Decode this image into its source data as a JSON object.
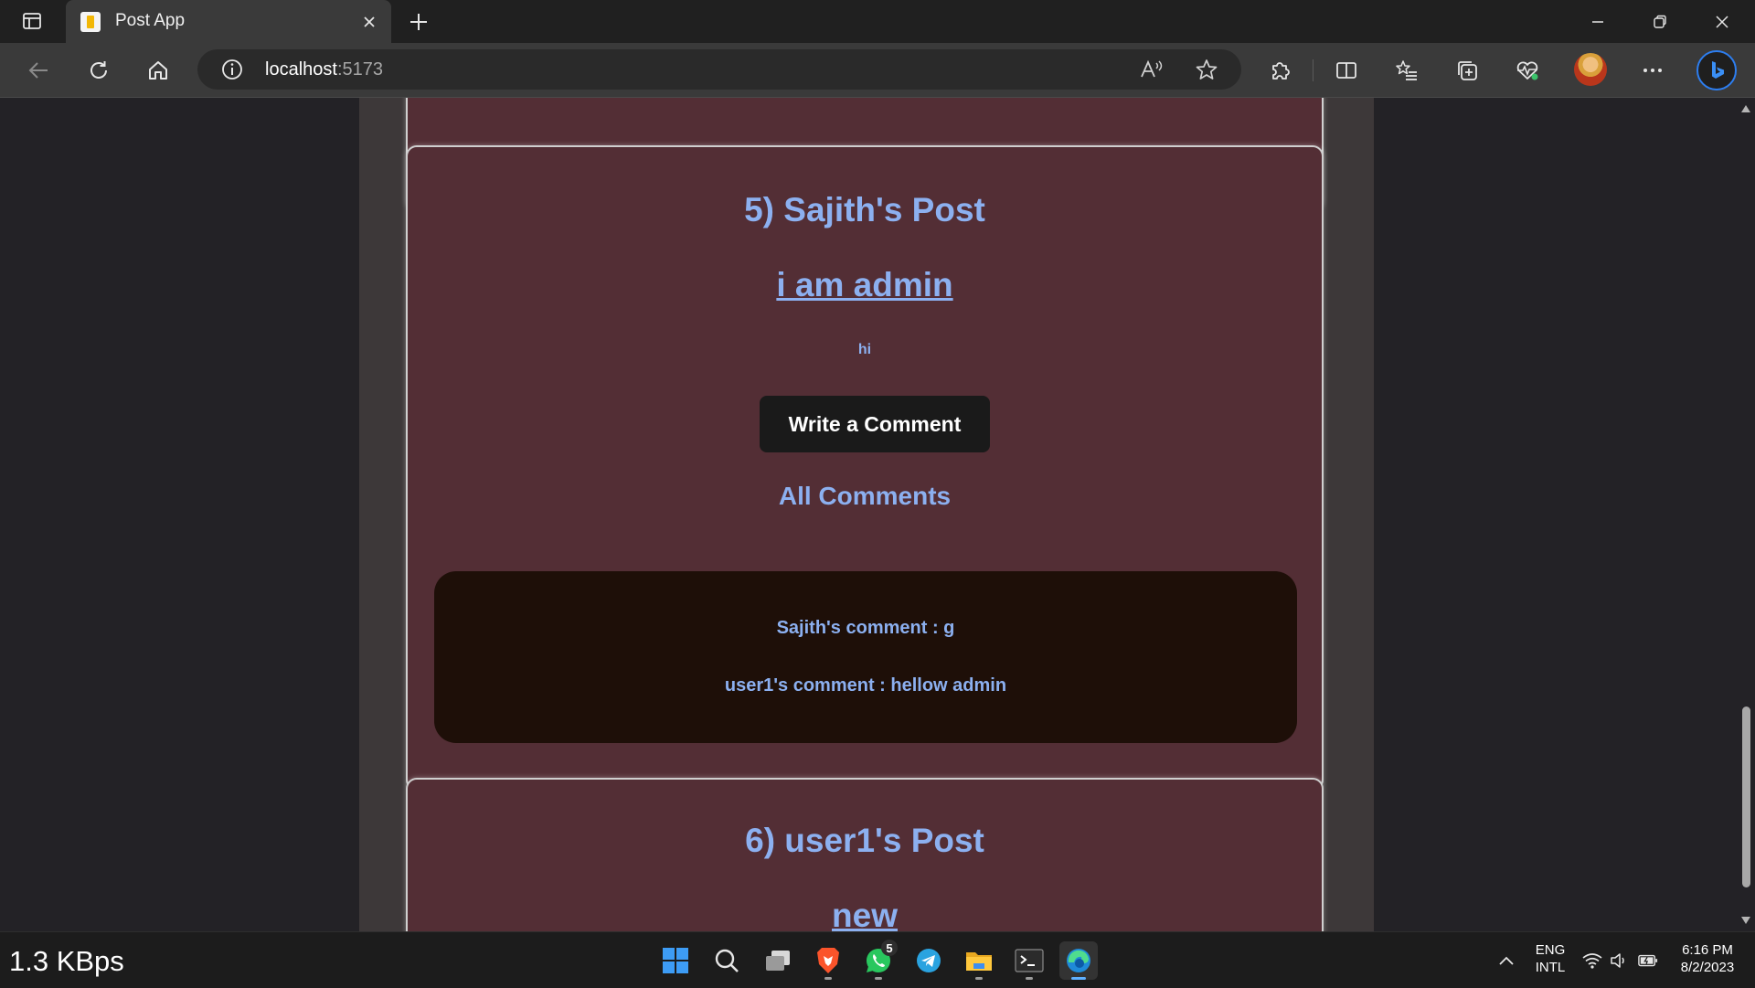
{
  "browser": {
    "tab_title": "Post App",
    "url_host": "localhost",
    "url_port": ":5173"
  },
  "posts": [
    {
      "heading": "5) Sajith's Post",
      "title": "i am admin",
      "body": "hi",
      "comment_button": "Write a Comment",
      "comments_heading": "All Comments",
      "comments": [
        "Sajith's comment : g",
        "user1's comment : hellow admin"
      ]
    },
    {
      "heading": "6) user1's Post",
      "title": "new"
    }
  ],
  "taskbar": {
    "network_speed": "1.3 KBps",
    "whatsapp_badge": "5",
    "language": "ENG",
    "layout": "INTL",
    "time": "6:16 PM",
    "date": "8/2/2023"
  },
  "colors": {
    "page_bg": "#232226",
    "column_bg": "#3d3839",
    "card_bg": "#532e35",
    "accent_text": "#8cb0f0",
    "comments_bg": "#1e0f08"
  }
}
